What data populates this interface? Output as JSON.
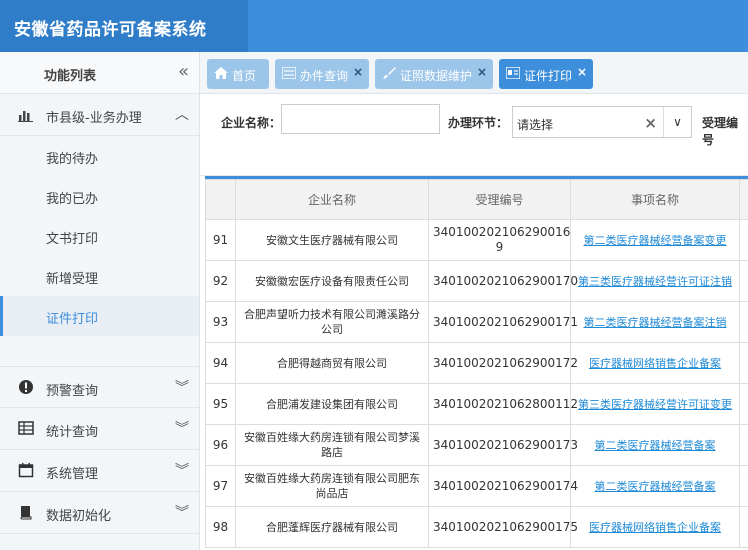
{
  "app": {
    "title": "安徽省药品许可备案系统"
  },
  "sidebar": {
    "header": "功能列表",
    "collapse_glyph": "«",
    "group_main": {
      "label": "市县级-业务办理",
      "chevron": "︿"
    },
    "sub_items": [
      {
        "label": "我的待办"
      },
      {
        "label": "我的已办"
      },
      {
        "label": "文书打印"
      },
      {
        "label": "新增受理"
      },
      {
        "label": "证件打印"
      }
    ],
    "groups": [
      {
        "label": "预警查询",
        "chevron": "︾"
      },
      {
        "label": "统计查询",
        "chevron": "︾"
      },
      {
        "label": "系统管理",
        "chevron": "︾"
      },
      {
        "label": "数据初始化",
        "chevron": "︾"
      }
    ]
  },
  "tabs": [
    {
      "label": "首页",
      "close": ""
    },
    {
      "label": "办件查询",
      "close": "×"
    },
    {
      "label": "证照数据维护",
      "close": "×"
    },
    {
      "label": "证件打印",
      "close": "×"
    }
  ],
  "filter": {
    "company_label": "企业名称：",
    "company_value": "",
    "stage_label": "办理环节：",
    "stage_value": "请选择",
    "clear_glyph": "×",
    "arrow_glyph": "∨",
    "accept_label": "受理编号"
  },
  "table": {
    "headers": [
      "",
      "企业名称",
      "受理编号",
      "事项名称"
    ],
    "rows": [
      {
        "no": "91",
        "company": "安徽文生医疗器械有限公司",
        "code": "340100202106290016​9",
        "item": "第二类医疗器械经营备案变更"
      },
      {
        "no": "92",
        "company": "安徽徽宏医疗设备有限责任公司",
        "code": "3401002021062900170",
        "item": "第三类医疗器械经营许可证注销"
      },
      {
        "no": "93",
        "company": "合肥声望听力技术有限公司濉溪路分公司",
        "code": "3401002021062900171",
        "item": "第二类医疗器械经营备案注销"
      },
      {
        "no": "94",
        "company": "合肥得越商贸有限公司",
        "code": "3401002021062900172",
        "item": "医疗器械网络销售企业备案"
      },
      {
        "no": "95",
        "company": "合肥浦发建设集团有限公司",
        "code": "3401002021062800112",
        "item": "第三类医疗器械经营许可证变更"
      },
      {
        "no": "96",
        "company": "安徽百姓缘大药房连锁有限公司梦溪路店",
        "code": "3401002021062900173",
        "item": "第二类医疗器械经营备案"
      },
      {
        "no": "97",
        "company": "安徽百姓缘大药房连锁有限公司肥东尚品店",
        "code": "3401002021062900174",
        "item": "第二类医疗器械经营备案"
      },
      {
        "no": "98",
        "company": "合肥蓬辉医疗器械有限公司",
        "code": "3401002021062900175",
        "item": "医疗器械网络销售企业备案"
      }
    ]
  }
}
